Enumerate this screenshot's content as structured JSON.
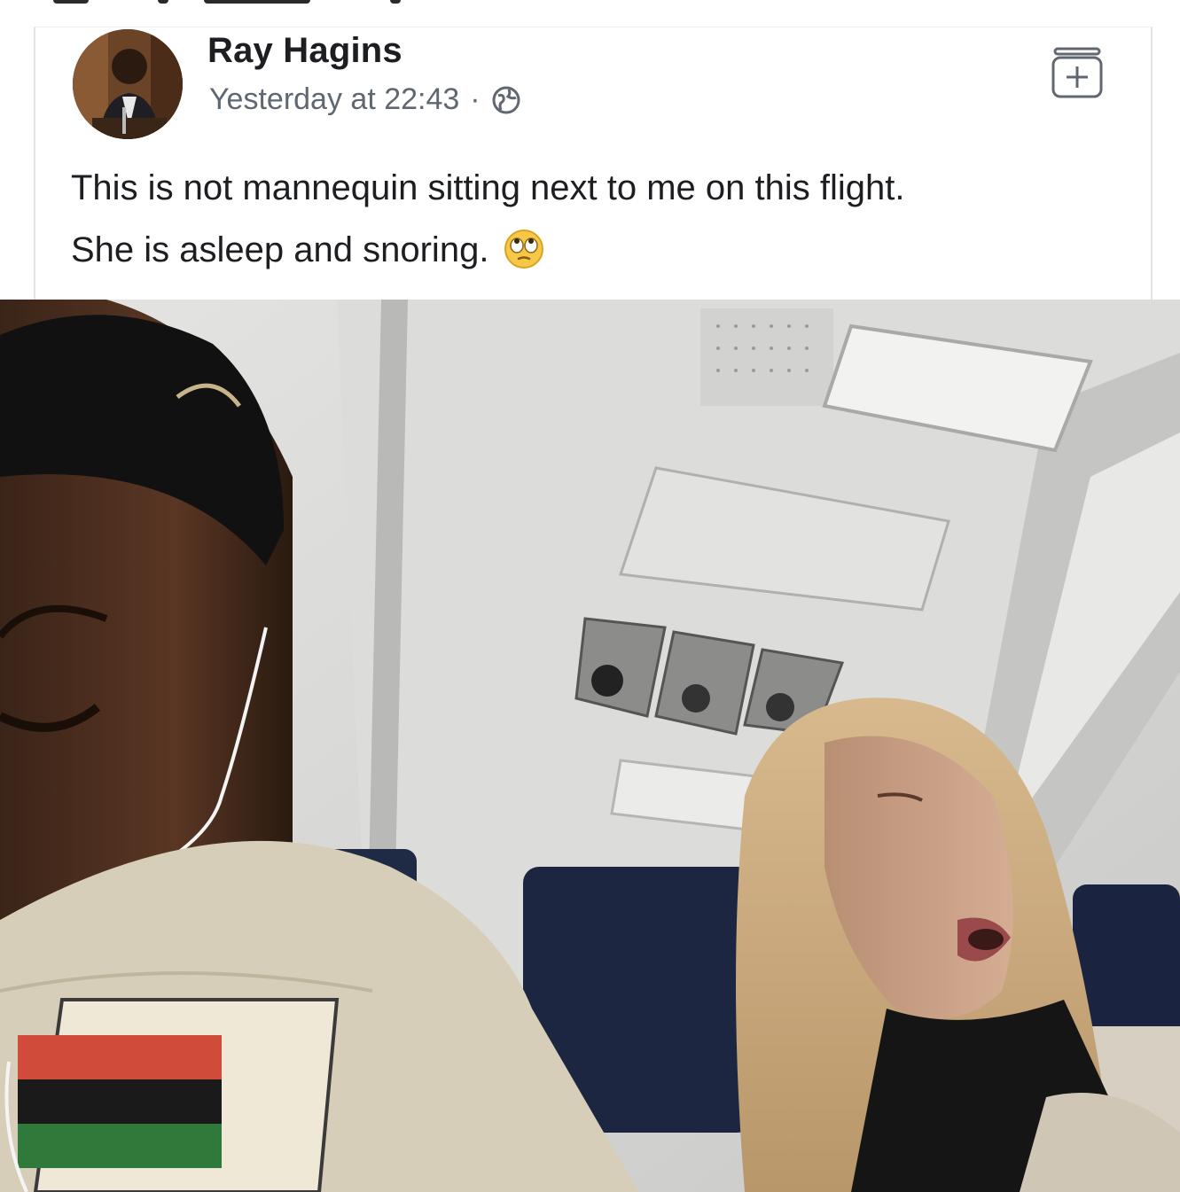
{
  "post": {
    "author": "Ray Hagins",
    "timestamp": "Yesterday at 22:43",
    "separator": "·",
    "privacy_icon": "globe-icon",
    "action_icon": "save-post-icon",
    "text_line_1": "This is not mannequin sitting next to me on this flight.",
    "text_line_2": "She is asleep and snoring.",
    "text_emoji": "face-with-rolling-eyes-emoji"
  },
  "photo": {
    "subject": "selfie-on-airplane"
  }
}
